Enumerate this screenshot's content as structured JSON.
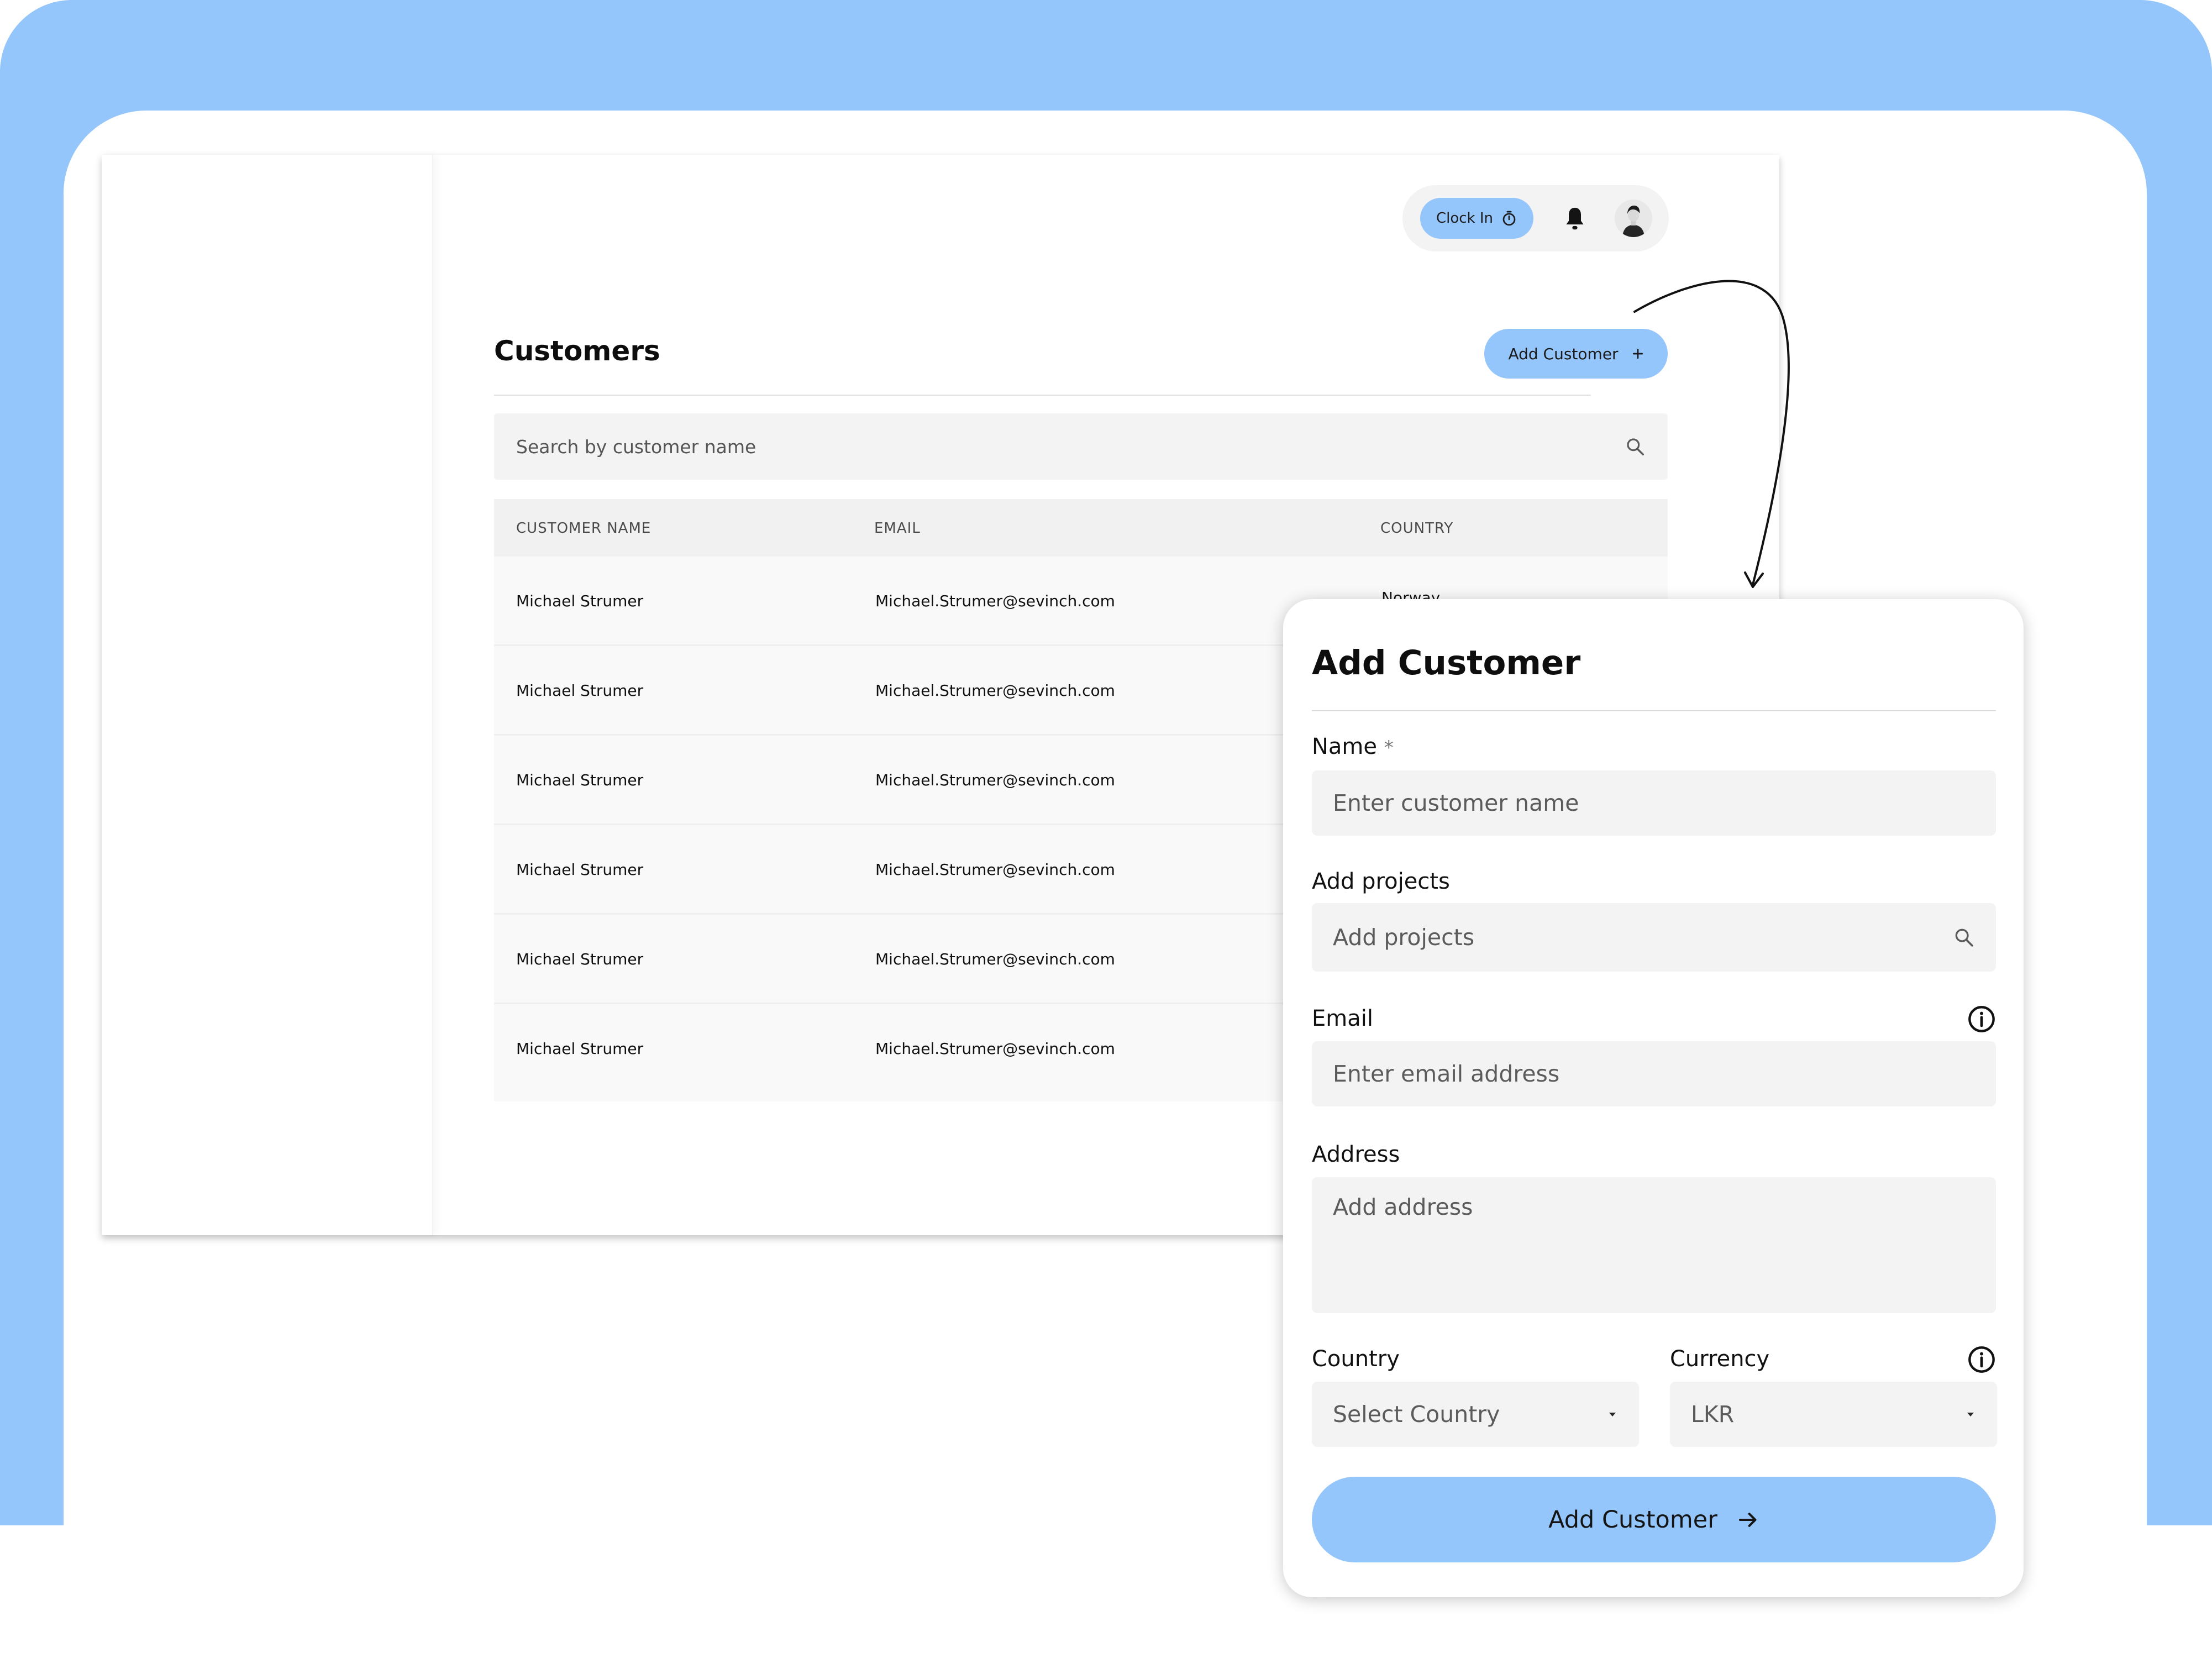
{
  "colors": {
    "accent": "#94c5fb",
    "field_bg": "#f3f3f3",
    "table_row_bg": "#f9f9f9"
  },
  "topbar": {
    "clock_in_label": "Clock In",
    "clock_icon": "stopwatch-icon",
    "bell_icon": "bell-icon",
    "avatar": "user-avatar"
  },
  "customers_page": {
    "title": "Customers",
    "add_button_label": "Add Customer",
    "add_button_icon": "plus-icon",
    "search": {
      "placeholder": "Search by customer name",
      "icon": "search-icon"
    },
    "table": {
      "columns": [
        "CUSTOMER NAME",
        "EMAIL",
        "COUNTRY"
      ],
      "rows": [
        {
          "name": "Michael Strumer",
          "email": "Michael.Strumer@sevinch.com",
          "country": "Norway"
        },
        {
          "name": "Michael Strumer",
          "email": "Michael.Strumer@sevinch.com",
          "country": ""
        },
        {
          "name": "Michael Strumer",
          "email": "Michael.Strumer@sevinch.com",
          "country": ""
        },
        {
          "name": "Michael Strumer",
          "email": "Michael.Strumer@sevinch.com",
          "country": ""
        },
        {
          "name": "Michael Strumer",
          "email": "Michael.Strumer@sevinch.com",
          "country": ""
        },
        {
          "name": "Michael Strumer",
          "email": "Michael.Strumer@sevinch.com",
          "country": ""
        }
      ]
    }
  },
  "modal": {
    "title": "Add Customer",
    "name": {
      "label": "Name",
      "required_mark": "*",
      "placeholder": "Enter customer name"
    },
    "projects": {
      "label": "Add projects",
      "placeholder": "Add projects",
      "icon": "search-icon"
    },
    "email": {
      "label": "Email",
      "placeholder": "Enter email address",
      "icon": "info-icon"
    },
    "address": {
      "label": "Address",
      "placeholder": "Add address"
    },
    "country": {
      "label": "Country",
      "value": "Select Country",
      "icon": "caret-down-icon"
    },
    "currency": {
      "label": "Currency",
      "value": "LKR",
      "icon": "caret-down-icon",
      "info_icon": "info-icon"
    },
    "submit": {
      "label": "Add Customer",
      "icon": "arrow-right-icon"
    }
  }
}
